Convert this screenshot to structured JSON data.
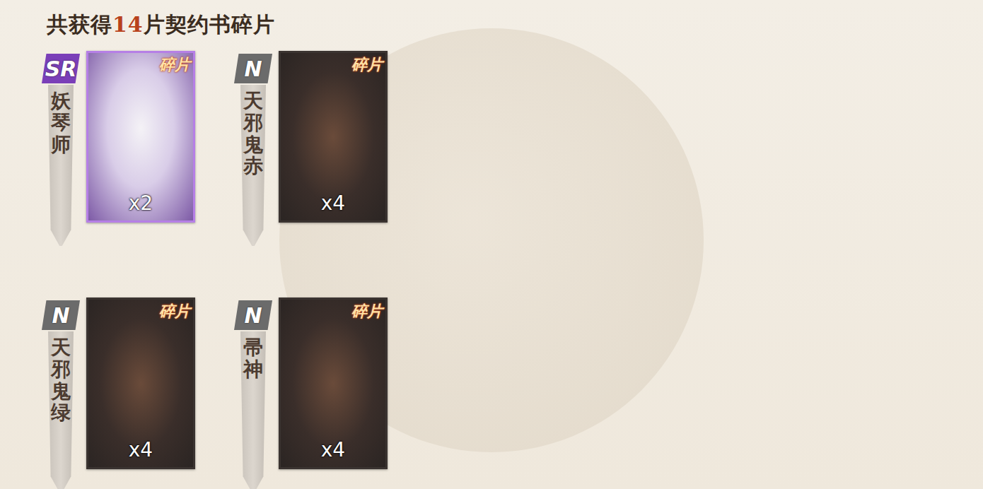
{
  "header": {
    "prefix": "共获得",
    "count": "14",
    "suffix": "片契约书碎片"
  },
  "shards": [
    {
      "rarity": "SR",
      "name": "妖琴师",
      "tag": "碎片",
      "count": "x2",
      "color": "#7a3fb8"
    },
    {
      "rarity": "N",
      "name": "天邪鬼赤",
      "tag": "碎片",
      "count": "x4",
      "color": "#6b6b6b"
    },
    {
      "rarity": "N",
      "name": "天邪鬼绿",
      "tag": "碎片",
      "count": "x4",
      "color": "#6b6b6b"
    },
    {
      "rarity": "N",
      "name": "帚神",
      "tag": "碎片",
      "count": "x4",
      "color": "#6b6b6b"
    }
  ]
}
